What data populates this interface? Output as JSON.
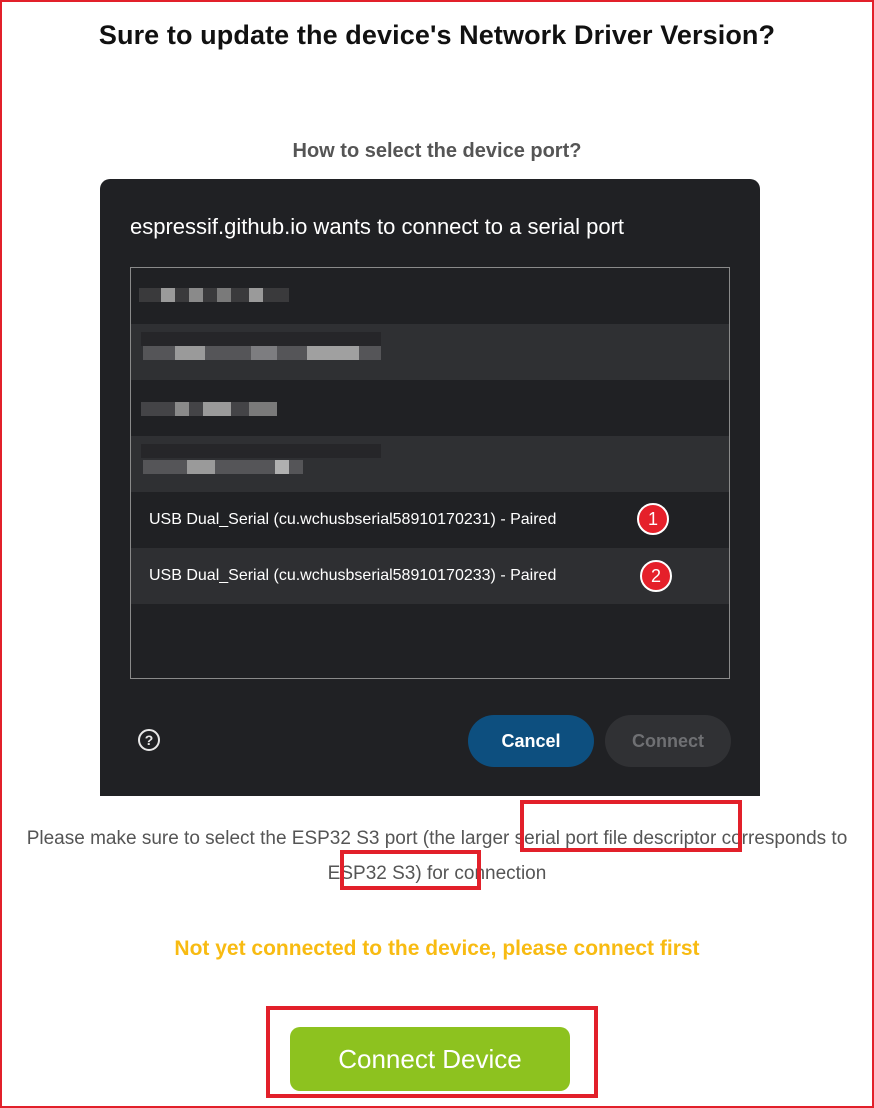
{
  "page": {
    "title": "Sure to update the device's Network Driver Version?",
    "subtitle": "How to select the device port?"
  },
  "dialog": {
    "title": "espressif.github.io wants to connect to a serial port",
    "ports": [
      {
        "label": "USB Dual_Serial (cu.wchusbserial58910170231) - Paired",
        "badge": "1"
      },
      {
        "label": "USB Dual_Serial (cu.wchusbserial58910170233) - Paired",
        "badge": "2"
      }
    ],
    "help_icon": "?",
    "cancel_label": "Cancel",
    "connect_label": "Connect"
  },
  "instructions": {
    "text": "Please make sure to select the ESP32 S3 port (the larger serial port file descriptor corresponds to ESP32 S3) for connection"
  },
  "status": {
    "message": "Not yet connected to the device, please connect first",
    "color": "#f8bb12"
  },
  "action": {
    "connect_device_label": "Connect Device",
    "color": "#8dc21f"
  },
  "colors": {
    "highlight": "#e2202a",
    "dialog_bg": "#202124",
    "cancel_bg": "#0d4f7f"
  }
}
